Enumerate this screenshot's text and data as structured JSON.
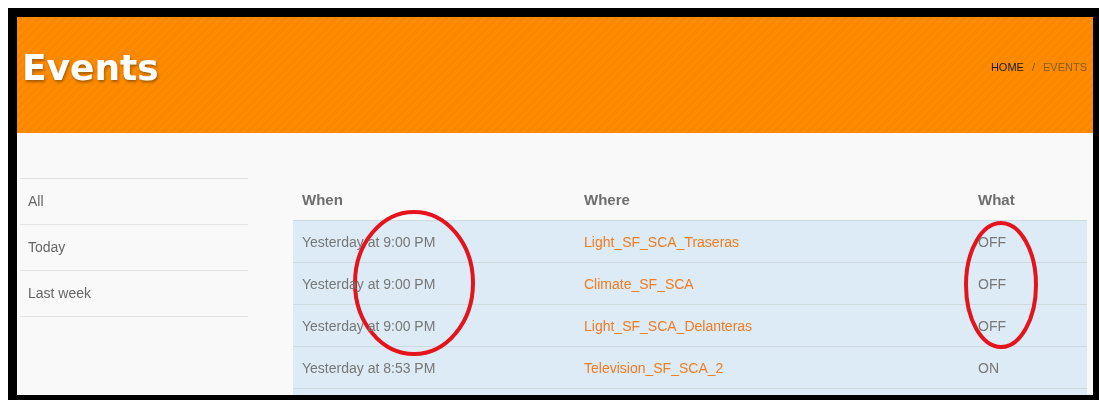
{
  "header": {
    "title": "Events",
    "breadcrumb": [
      {
        "label": "HOME",
        "current": false
      },
      {
        "label": "/",
        "kind": "separator"
      },
      {
        "label": "EVENTS",
        "current": true
      }
    ]
  },
  "sidebar": {
    "items": [
      {
        "label": "All"
      },
      {
        "label": "Today"
      },
      {
        "label": "Last week"
      }
    ]
  },
  "table": {
    "columns": [
      "When",
      "Where",
      "What"
    ],
    "rows": [
      {
        "when": "Yesterday at 9:00 PM",
        "where": "Light_SF_SCA_Traseras",
        "what": "OFF"
      },
      {
        "when": "Yesterday at 9:00 PM",
        "where": "Climate_SF_SCA",
        "what": "OFF"
      },
      {
        "when": "Yesterday at 9:00 PM",
        "where": "Light_SF_SCA_Delanteras",
        "what": "OFF"
      },
      {
        "when": "Yesterday at 8:53 PM",
        "where": "Television_SF_SCA_2",
        "what": "ON"
      }
    ]
  }
}
